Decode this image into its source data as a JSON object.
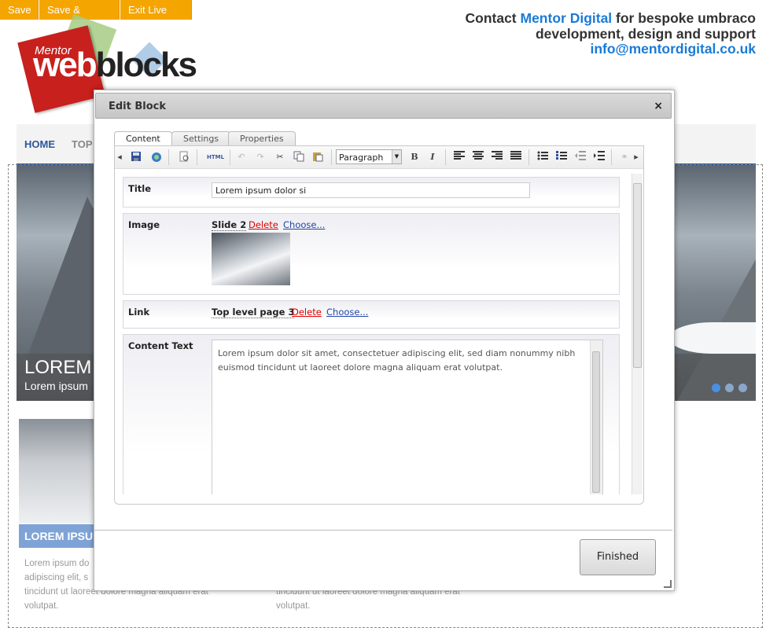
{
  "topbar": {
    "save": "Save",
    "save_publish": "Save & Publish",
    "exit": "Exit Live Edit"
  },
  "contact": {
    "line1_prefix": "Contact ",
    "line1_brand": "Mentor Digital",
    "line1_suffix": " for bespoke umbraco",
    "line2": "development, design and support",
    "email": "info@mentordigital.co.uk"
  },
  "logo": {
    "mentor": "Mentor",
    "web": "web",
    "blocks": "blocks"
  },
  "nav": {
    "home": "HOME",
    "top": "TOP"
  },
  "hero": {
    "title": "LOREM I",
    "subtitle": "Lorem ipsum"
  },
  "teaser": {
    "title": "LOREM IPSU",
    "left_text": [
      "Lorem ipsum do",
      "adipiscing elit, s",
      "tincidunt ut laoreet dolore magna aliquam erat",
      "volutpat."
    ],
    "right_text": [
      "tincidunt ut laoreet dolore magna aliquam erat",
      "volutpat."
    ]
  },
  "dialog": {
    "title": "Edit Block",
    "close": "×",
    "tabs": [
      "Content",
      "Settings",
      "Properties"
    ],
    "toolbar": {
      "format": "Paragraph",
      "icons": [
        "scroll-left",
        "save",
        "spellcheck",
        "preview",
        "html",
        "undo",
        "redo",
        "cut",
        "copy",
        "paste",
        "bold",
        "italic",
        "align-left",
        "align-center",
        "align-right",
        "justify",
        "bullet-list",
        "number-list",
        "outdent",
        "indent",
        "link",
        "scroll-right"
      ],
      "html_label": "HTML",
      "bold_label": "B",
      "italic_label": "I"
    },
    "fields": {
      "title_label": "Title",
      "title_value": "Lorem ipsum dolor si",
      "image_label": "Image",
      "image_value": "Slide 2",
      "link_label": "Link",
      "link_value": "Top level page 3",
      "delete": "Delete",
      "choose": "Choose...",
      "content_label": "Content Text",
      "content_value": "Lorem ipsum dolor sit amet, consectetuer adipiscing elit, sed diam nonummy nibh euismod tincidunt ut laoreet dolore magna aliquam erat volutpat."
    },
    "finished": "Finished"
  },
  "colors": {
    "accent_orange": "#f5a500",
    "brand_blue": "#1a7bd6",
    "delete_red": "#dd0000",
    "link_blue": "#2246a8"
  }
}
